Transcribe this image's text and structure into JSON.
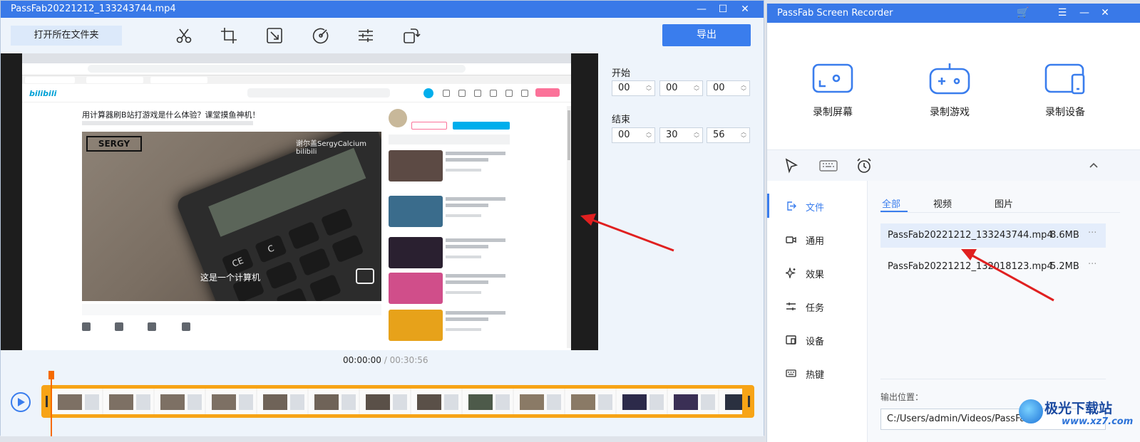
{
  "editor": {
    "title": "PassFab20221212_133243744.mp4",
    "open_folder_label": "打开所在文件夹",
    "export_label": "导出",
    "tools": [
      "scissors-icon",
      "crop-icon",
      "resize-icon",
      "speed-icon",
      "adjust-icon",
      "rotate-icon"
    ],
    "preview": {
      "video_title": "用计算器刷B站打游戏是什么体验？课堂摸鱼神机！",
      "subtitle": "这是一个计算机",
      "logo_text": "SERGY",
      "watermark": "谢尔盖SergyCalcium  bilibili",
      "bili_logo": "bilibili"
    },
    "start_label": "开始",
    "end_label": "结束",
    "start": {
      "h": "00",
      "m": "00",
      "s": "00"
    },
    "end": {
      "h": "00",
      "m": "30",
      "s": "56"
    },
    "current_time": "00:00:00",
    "separator": "/",
    "total_time": "00:30:56"
  },
  "recorder": {
    "title": "PassFab Screen Recorder",
    "modes": [
      {
        "label": "录制屏幕",
        "icon": "record-screen-icon"
      },
      {
        "label": "录制游戏",
        "icon": "gamepad-icon"
      },
      {
        "label": "录制设备",
        "icon": "device-icon"
      }
    ],
    "nav": [
      {
        "label": "文件",
        "icon": "file-export-icon",
        "active": true
      },
      {
        "label": "通用",
        "icon": "camera-icon"
      },
      {
        "label": "效果",
        "icon": "sparkle-icon"
      },
      {
        "label": "任务",
        "icon": "task-icon"
      },
      {
        "label": "设备",
        "icon": "device-small-icon"
      },
      {
        "label": "热键",
        "icon": "keyboard-icon"
      }
    ],
    "tabs": [
      "全部",
      "视频",
      "图片"
    ],
    "files": [
      {
        "name": "PassFab20221212_133243744.mp4",
        "size": "8.6MB",
        "more": "···",
        "selected": true
      },
      {
        "name": "PassFab20221212_132018123.mp4",
        "size": "5.2MB",
        "more": "···"
      }
    ],
    "output_label": "输出位置：",
    "output_path": "C:/Users/admin/Videos/PassFab"
  },
  "watermark_brand": {
    "name": "极光下载站",
    "url": "www.xz7.com"
  },
  "colors": {
    "accent": "#3a7ded",
    "titlebar": "#3979e8",
    "timeline_frame": "#f7a416",
    "arrow": "#e02020"
  }
}
